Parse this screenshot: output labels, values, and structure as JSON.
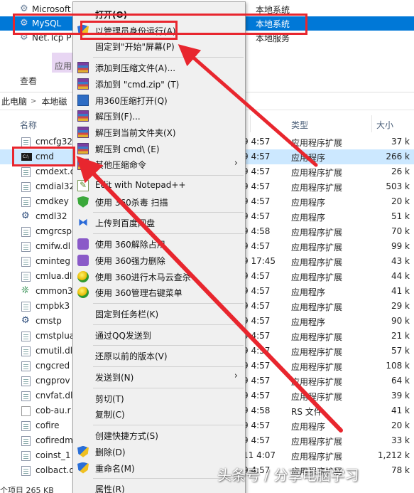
{
  "services": [
    {
      "name": "Microsoft",
      "type": "本地系统",
      "selected": false
    },
    {
      "name": "MySQL",
      "type": "本地系统",
      "selected": true
    },
    {
      "name": "Net.Tcp P",
      "type": "本地服务",
      "selected": false
    }
  ],
  "ribbon": {
    "app_tools_tab": "应用",
    "view_tab": "查看"
  },
  "breadcrumb": {
    "items": [
      "此电脑",
      "本地磁"
    ],
    "separator": ">"
  },
  "columns": {
    "name": "名称",
    "type": "类型",
    "size": "大小"
  },
  "files": [
    {
      "name": "cmcfg32",
      "date": "9 4:57",
      "type": "应用程序扩展",
      "size": "37 k",
      "icon": "doc"
    },
    {
      "name": "cmd",
      "date": "9 4:57",
      "type": "应用程序",
      "size": "266 k",
      "icon": "cmd",
      "selected": true
    },
    {
      "name": "cmdext.d",
      "date": "9 4:57",
      "type": "应用程序扩展",
      "size": "26 k",
      "icon": "doc"
    },
    {
      "name": "cmdial32",
      "date": "9 4:57",
      "type": "应用程序扩展",
      "size": "503 k",
      "icon": "doc"
    },
    {
      "name": "cmdkey",
      "date": "9 4:57",
      "type": "应用程序",
      "size": "20 k",
      "icon": "doc"
    },
    {
      "name": "cmdl32",
      "date": "9 4:57",
      "type": "应用程序",
      "size": "51 k",
      "icon": "gear"
    },
    {
      "name": "cmgrcsp",
      "date": "9 4:58",
      "type": "应用程序扩展",
      "size": "70 k",
      "icon": "doc"
    },
    {
      "name": "cmifw.dl",
      "date": "9 4:57",
      "type": "应用程序扩展",
      "size": "99 k",
      "icon": "doc"
    },
    {
      "name": "cminteg",
      "date": "9 17:45",
      "type": "应用程序扩展",
      "size": "43 k",
      "icon": "doc"
    },
    {
      "name": "cmlua.dl",
      "date": "9 4:57",
      "type": "应用程序扩展",
      "size": "44 k",
      "icon": "doc"
    },
    {
      "name": "cmmon3",
      "date": "9 4:57",
      "type": "应用程序",
      "size": "41 k",
      "icon": "net"
    },
    {
      "name": "cmpbk3",
      "date": "9 4:57",
      "type": "应用程序扩展",
      "size": "29 k",
      "icon": "doc"
    },
    {
      "name": "cmstp",
      "date": "9 4:57",
      "type": "应用程序",
      "size": "90 k",
      "icon": "gear"
    },
    {
      "name": "cmstplua",
      "date": "9 4:57",
      "type": "应用程序扩展",
      "size": "21 k",
      "icon": "doc"
    },
    {
      "name": "cmutil.dl",
      "date": "9 4:57",
      "type": "应用程序扩展",
      "size": "57 k",
      "icon": "doc"
    },
    {
      "name": "cngcred",
      "date": "9 4:57",
      "type": "应用程序扩展",
      "size": "108 k",
      "icon": "doc"
    },
    {
      "name": "cngprov",
      "date": "9 4:57",
      "type": "应用程序扩展",
      "size": "64 k",
      "icon": "doc"
    },
    {
      "name": "cnvfat.dl",
      "date": "9 4:57",
      "type": "应用程序扩展",
      "size": "39 k",
      "icon": "doc"
    },
    {
      "name": "cob-au.r",
      "date": "9 4:58",
      "type": "RS 文件",
      "size": "41 k",
      "icon": "rs"
    },
    {
      "name": "cofire",
      "date": "9 4:57",
      "type": "应用程序",
      "size": "20 k",
      "icon": "doc"
    },
    {
      "name": "cofiredm",
      "date": "9 4:57",
      "type": "应用程序扩展",
      "size": "33 k",
      "icon": "doc"
    },
    {
      "name": "coinst_1",
      "date": "11 4:07",
      "type": "应用程序扩展",
      "size": "1,212 k",
      "icon": "doc"
    },
    {
      "name": "colbact.d",
      "date": "9 4:57",
      "type": "应用程序扩展",
      "size": "78 k",
      "icon": "doc"
    }
  ],
  "status_bar": "个项目  265 KB",
  "context_menu": {
    "items": [
      {
        "label": "打开(O)",
        "icon": "",
        "bold": true
      },
      {
        "label": "以管理员身份运行(A)",
        "icon": "shield"
      },
      {
        "label": "固定到\"开始\"屏幕(P)",
        "icon": ""
      },
      {
        "separator": true
      },
      {
        "label": "添加到压缩文件(A)...",
        "icon": "winrar"
      },
      {
        "label": "添加到 \"cmd.zip\" (T)",
        "icon": "winrar"
      },
      {
        "label": "用360压缩打开(Q)",
        "icon": "zip360"
      },
      {
        "label": "解压到(F)...",
        "icon": "winrar"
      },
      {
        "label": "解压到当前文件夹(X)",
        "icon": "winrar"
      },
      {
        "label": "解压到 cmd\\ (E)",
        "icon": "winrar"
      },
      {
        "label": "其他压缩命令",
        "icon": "winrar",
        "submenu": true
      },
      {
        "separator": true
      },
      {
        "label": "Edit with Notepad++",
        "icon": "npp"
      },
      {
        "label": "使用 360杀毒 扫描",
        "icon": "s360"
      },
      {
        "separator": true
      },
      {
        "label": "上传到百度网盘",
        "icon": "baidu"
      },
      {
        "separator": true
      },
      {
        "label": "使用 360解除占用",
        "icon": "purple"
      },
      {
        "label": "使用 360强力删除",
        "icon": "purple"
      },
      {
        "label": "使用 360进行木马云查杀",
        "icon": "ball360"
      },
      {
        "label": "使用 360管理右键菜单",
        "icon": "ball360"
      },
      {
        "separator": true
      },
      {
        "label": "固定到任务栏(K)",
        "icon": ""
      },
      {
        "separator": true
      },
      {
        "label": "通过QQ发送到",
        "icon": ""
      },
      {
        "separator": true
      },
      {
        "label": "还原以前的版本(V)",
        "icon": ""
      },
      {
        "separator": true
      },
      {
        "label": "发送到(N)",
        "icon": "",
        "submenu": true
      },
      {
        "separator": true
      },
      {
        "label": "剪切(T)",
        "icon": ""
      },
      {
        "label": "复制(C)",
        "icon": ""
      },
      {
        "separator": true
      },
      {
        "label": "创建快捷方式(S)",
        "icon": ""
      },
      {
        "label": "删除(D)",
        "icon": "shield"
      },
      {
        "label": "重命名(M)",
        "icon": "shield"
      },
      {
        "separator": true
      },
      {
        "label": "属性(R)",
        "icon": ""
      }
    ]
  },
  "watermark": "头条号 / 分享电脑学习",
  "colors": {
    "selection_blue": "#0078d7",
    "selection_light": "#cce8ff",
    "annotation_red": "#e8262e"
  }
}
